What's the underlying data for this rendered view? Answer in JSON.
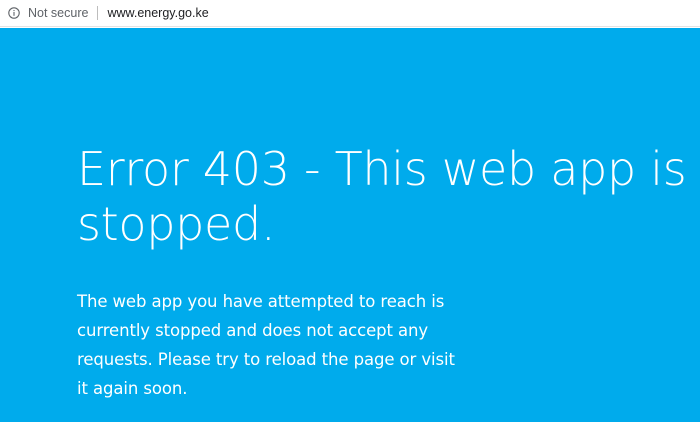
{
  "address_bar": {
    "security_icon": "info-icon",
    "security_label": "Not secure",
    "url": "www.energy.go.ke"
  },
  "error_page": {
    "background_color": "#00abec",
    "text_color": "#ffffff",
    "heading_lines": [
      "Error 403 - This web app is",
      "stopped."
    ],
    "message_lines": [
      "The web app you have attempted to reach is",
      "currently stopped and does not accept any",
      "requests. Please try to reload the page or visit",
      "it again soon."
    ]
  }
}
